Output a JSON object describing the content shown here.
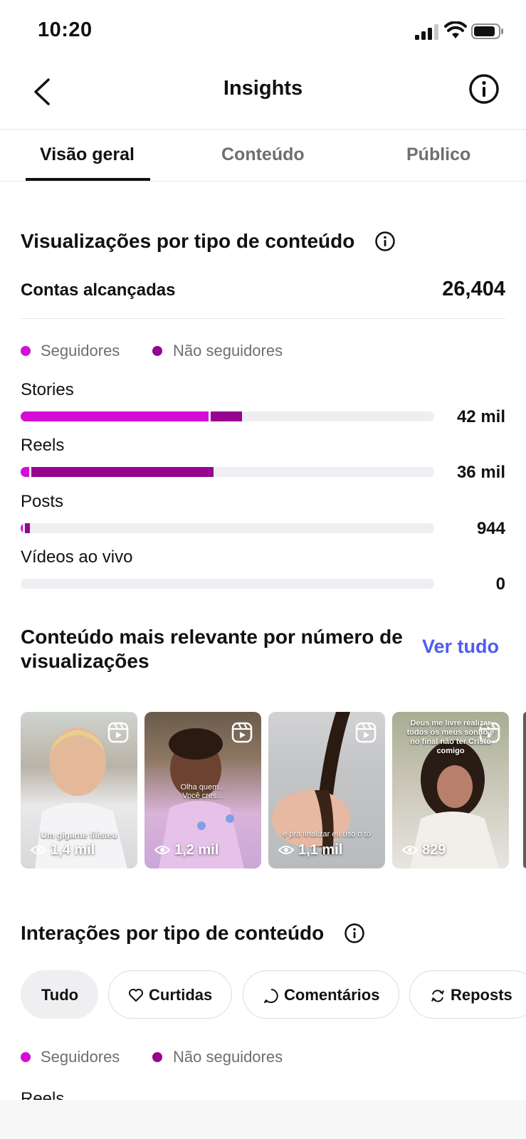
{
  "status_bar": {
    "time": "10:20"
  },
  "header": {
    "title": "Insights"
  },
  "tabs": [
    {
      "label": "Visão geral",
      "active": true
    },
    {
      "label": "Conteúdo",
      "active": false
    },
    {
      "label": "Público",
      "active": false
    }
  ],
  "views_section": {
    "title": "Visualizações por tipo de conteúdo",
    "reach_label": "Contas alcançadas",
    "reach_value": "26,404",
    "legend": {
      "followers": "Seguidores",
      "non_followers": "Não seguidores"
    },
    "colors": {
      "followers": "#d60dd6",
      "non_followers": "#95058f",
      "track": "#efeff3"
    },
    "bars": [
      {
        "label": "Stories",
        "value": "42 mil",
        "followers_frac": 0.455,
        "non_followers_frac": 0.075
      },
      {
        "label": "Reels",
        "value": "36 mil",
        "followers_frac": 0.02,
        "non_followers_frac": 0.44
      },
      {
        "label": "Posts",
        "value": "944",
        "followers_frac": 0.005,
        "non_followers_frac": 0.012
      },
      {
        "label": "Vídeos ao vivo",
        "value": "0",
        "followers_frac": 0,
        "non_followers_frac": 0
      }
    ]
  },
  "top_content": {
    "title_line1": "Conteúdo mais relevante por número de",
    "title_line2": "visualizações",
    "see_all": "Ver tudo",
    "items": [
      {
        "caption": "Um gigante filisteu",
        "views": "1,4 mil"
      },
      {
        "caption": "Olha quem... Você cres...",
        "views": "1,2 mil"
      },
      {
        "caption": "e pra finalizar eu uso o tô",
        "views": "1,1 mil"
      },
      {
        "caption": "Deus me livre realizar todos os meus sonho e no final não ter Cristo comigo",
        "views": "829"
      }
    ]
  },
  "interactions_section": {
    "title": "Interações por tipo de conteúdo",
    "chips": [
      {
        "label": "Tudo",
        "icon": ""
      },
      {
        "label": "Curtidas",
        "icon": "heart-icon"
      },
      {
        "label": "Comentários",
        "icon": "comment-icon"
      },
      {
        "label": "Reposts",
        "icon": "repost-icon"
      }
    ],
    "legend": {
      "followers": "Seguidores",
      "non_followers": "Não seguidores"
    },
    "first_row_label": "Reels"
  }
}
